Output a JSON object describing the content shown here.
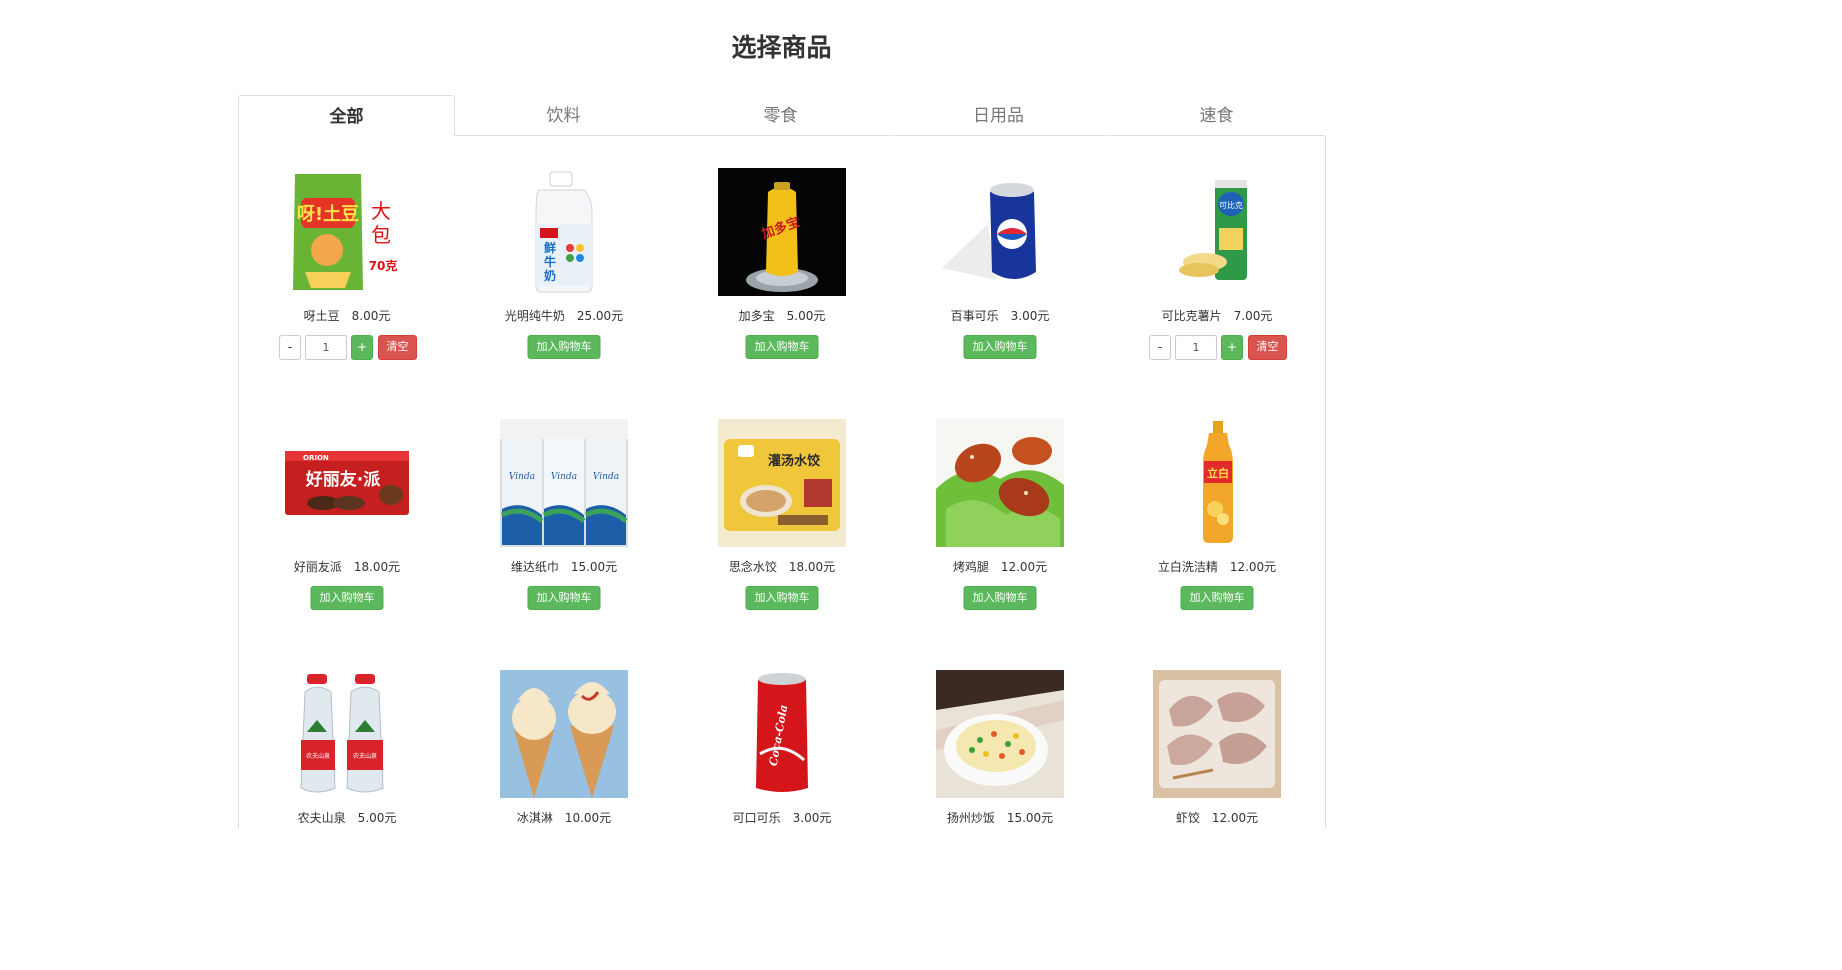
{
  "page": {
    "title": "选择商品"
  },
  "tabs": [
    {
      "label": "全部",
      "active": true
    },
    {
      "label": "饮料",
      "active": false
    },
    {
      "label": "零食",
      "active": false
    },
    {
      "label": "日用品",
      "active": false
    },
    {
      "label": "速食",
      "active": false
    }
  ],
  "buttons": {
    "add_to_cart": "加入购物车",
    "minus": "-",
    "plus": "+",
    "clear": "清空"
  },
  "products": [
    {
      "name": "呀土豆",
      "price": "8.00元",
      "in_cart": true,
      "quantity": "1",
      "image_icon": "snack-bag-icon"
    },
    {
      "name": "光明纯牛奶",
      "price": "25.00元",
      "in_cart": false,
      "image_icon": "milk-jug-icon"
    },
    {
      "name": "加多宝",
      "price": "5.00元",
      "in_cart": false,
      "image_icon": "herbal-tea-can-icon"
    },
    {
      "name": "百事可乐",
      "price": "3.00元",
      "in_cart": false,
      "image_icon": "pepsi-can-icon"
    },
    {
      "name": "可比克薯片",
      "price": "7.00元",
      "in_cart": true,
      "quantity": "1",
      "image_icon": "chips-tube-icon"
    },
    {
      "name": "好丽友派",
      "price": "18.00元",
      "in_cart": false,
      "image_icon": "choco-pie-box-icon"
    },
    {
      "name": "维达纸巾",
      "price": "15.00元",
      "in_cart": false,
      "image_icon": "tissue-pack-icon"
    },
    {
      "name": "思念水饺",
      "price": "18.00元",
      "in_cart": false,
      "image_icon": "dumpling-bag-icon"
    },
    {
      "name": "烤鸡腿",
      "price": "12.00元",
      "in_cart": false,
      "image_icon": "chicken-leg-icon"
    },
    {
      "name": "立白洗洁精",
      "price": "12.00元",
      "in_cart": false,
      "image_icon": "detergent-bottle-icon"
    },
    {
      "name": "农夫山泉",
      "price": "5.00元",
      "in_cart": false,
      "image_icon": "water-bottle-icon"
    },
    {
      "name": "冰淇淋",
      "price": "10.00元",
      "in_cart": false,
      "image_icon": "ice-cream-icon"
    },
    {
      "name": "可口可乐",
      "price": "3.00元",
      "in_cart": false,
      "image_icon": "coke-can-icon"
    },
    {
      "name": "扬州炒饭",
      "price": "15.00元",
      "in_cart": false,
      "image_icon": "fried-rice-icon"
    },
    {
      "name": "虾饺",
      "price": "12.00元",
      "in_cart": false,
      "image_icon": "shrimp-dumpling-icon"
    }
  ],
  "image_text": {
    "0": {
      "t1": "呀!土豆",
      "t2": "大",
      "t3": "包",
      "t4": "70克"
    },
    "1": {
      "t1": "鲜",
      "t2": "牛",
      "t3": "奶"
    },
    "2": {
      "t1": "加多宝"
    },
    "4": {
      "t1": "可比克"
    },
    "5": {
      "t1": "ORION",
      "t2": "好丽友·派"
    },
    "6": {
      "t1": "Vinda"
    },
    "7": {
      "t1": "灌汤水饺"
    },
    "9": {
      "t1": "立白"
    },
    "10": {
      "t1": "农夫山泉"
    },
    "12": {
      "t1": "Coca-Cola"
    }
  }
}
